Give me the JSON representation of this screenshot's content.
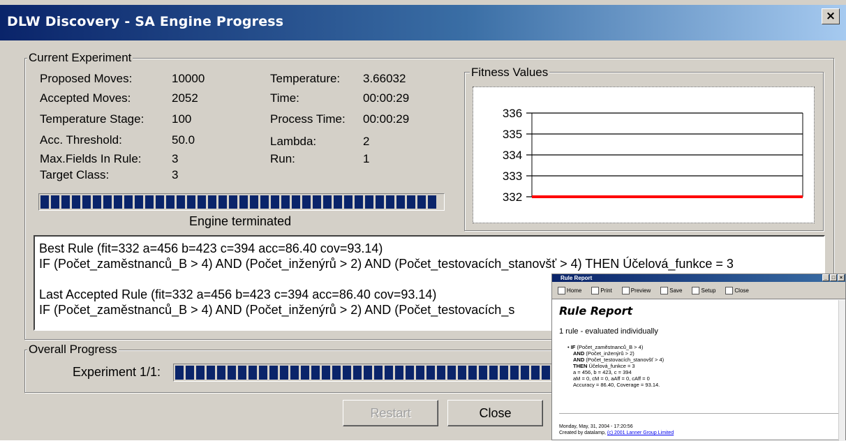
{
  "window": {
    "title": "DLW Discovery - SA Engine Progress",
    "close_glyph": "×"
  },
  "current_experiment": {
    "group_label": "Current Experiment",
    "left_fields": [
      {
        "label": "Proposed Moves:",
        "value": "10000"
      },
      {
        "label": "Accepted Moves:",
        "value": "2052"
      },
      {
        "label": "Temperature Stage:",
        "value": "100"
      },
      {
        "label": "Acc. Threshold:",
        "value": "50.0"
      },
      {
        "label": "Max.Fields In Rule:",
        "value": "3"
      },
      {
        "label": "Target Class:",
        "value": "3"
      }
    ],
    "right_fields": [
      {
        "label": "Temperature:",
        "value": "3.66032"
      },
      {
        "label": "Time:",
        "value": "00:00:29"
      },
      {
        "label": "Process Time:",
        "value": "00:00:29"
      },
      {
        "label": "Lambda:",
        "value": "2"
      },
      {
        "label": "Run:",
        "value": "1"
      }
    ],
    "progress": {
      "fraction": 1.0,
      "status": "Engine terminated"
    }
  },
  "fitness": {
    "group_label": "Fitness Values",
    "chart_data": {
      "type": "line",
      "title": "",
      "y_ticks": [
        "336",
        "335",
        "334",
        "333",
        "332"
      ],
      "ylim": [
        332,
        336
      ],
      "series": [
        {
          "values": [
            332,
            332
          ],
          "color": "#ff0000"
        }
      ]
    }
  },
  "rules": {
    "lines": [
      "Best Rule (fit=332 a=456 b=423 c=394 acc=86.40 cov=93.14)",
      " IF (Počet_zaměstnanců_B > 4) AND (Počet_inženýrů > 2) AND (Počet_testovacích_stanovšť > 4) THEN Účelová_funkce = 3",
      "",
      "Last Accepted Rule (fit=332 a=456 b=423 c=394 acc=86.40 cov=93.14)",
      " IF (Počet_zaměstnanců_B > 4) AND (Počet_inženýrů > 2) AND (Počet_testovacích_s"
    ]
  },
  "overall": {
    "group_label": "Overall Progress",
    "experiment_label": "Experiment 1/1:",
    "progress_fraction": 1.0
  },
  "buttons": {
    "restart": "Restart",
    "close": "Close"
  },
  "rule_report": {
    "title": "Rule Report",
    "toolbar": [
      "Home",
      "Print",
      "Preview",
      "Save",
      "Setup",
      "Close"
    ],
    "heading": "Rule Report",
    "subheading": "1 rule - evaluated individually",
    "rule_lines": [
      {
        "kw": "IF",
        "text": " (Počet_zaměstnanců_B > 4)"
      },
      {
        "kw": "AND",
        "text": " (Počet_inženýrů > 2)"
      },
      {
        "kw": "AND",
        "text": " (Počet_testovacích_stanovšť > 4)"
      },
      {
        "kw": "THEN",
        "text": " Účelová_funkce = 3"
      },
      {
        "kw": "",
        "text": "a = 456, b = 423, c = 394"
      },
      {
        "kw": "",
        "text": "aM = 0, cM = 0, aAff = 0, cAff = 0"
      },
      {
        "kw": "",
        "text": "Accuracy = 86.40, Coverage = 93.14."
      }
    ],
    "footer_date": "Monday, May, 31, 2004 - 17:20:56",
    "footer_created": "Created by datalamp,",
    "footer_link": "(c) 2001 Lanner Group Limited"
  }
}
